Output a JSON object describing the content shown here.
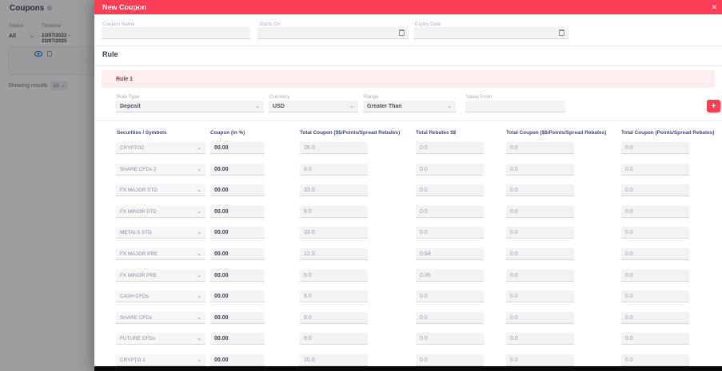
{
  "background": {
    "title": "Coupons",
    "gear_icon": "gear-icon",
    "status_label": "Status",
    "status_value": "All",
    "timeline_label": "Timeline",
    "timeline_value": "23/07/2022 - 22/07/2025",
    "showing_results_label": "Showing results",
    "showing_results_value": "10",
    "card_icons": [
      "eye-icon",
      "copy-icon"
    ]
  },
  "modal": {
    "title": "New Coupon",
    "close_icon": "✕",
    "form": {
      "coupon_name_label": "Coupon Name",
      "coupon_name_value": "",
      "starts_on_label": "Starts On",
      "starts_on_value": "",
      "expiry_date_label": "Expiry Date",
      "expiry_date_value": ""
    },
    "rule_section": {
      "heading": "Rule",
      "rule_banner": "Rule 1",
      "rule_type_label": "Rule Type",
      "rule_type_value": "Deposit",
      "currency_label": "Currency",
      "currency_value": "USD",
      "range_label": "Range",
      "range_value": "Greater Than",
      "value_from_label": "Value From",
      "value_from_value": "",
      "add_button_label": "+"
    },
    "table": {
      "headers": [
        "Securities / Symbols",
        "Coupon (in %)",
        "Total Coupon ($$/Points/Spread Rebates)",
        "Total Rebates $$",
        "Total Coupon ($$/Points/Spread Rebates)",
        "Total Coupon (Points/Spread Rebates)"
      ],
      "rows": [
        {
          "security": "CRYPTO2",
          "coupon": "00.00",
          "total_coupon": "26.0",
          "total_rebates": "0.0",
          "total_coupon_2": "0.0",
          "total_coupon_3": "0.0"
        },
        {
          "security": "SHARE CFDs 2",
          "coupon": "00.00",
          "total_coupon": "9.0",
          "total_rebates": "0.0",
          "total_coupon_2": "0.0",
          "total_coupon_3": "0.0"
        },
        {
          "security": "FX MAJOR STD",
          "coupon": "00.00",
          "total_coupon": "33.0",
          "total_rebates": "0.0",
          "total_coupon_2": "0.0",
          "total_coupon_3": "0.0"
        },
        {
          "security": "FX MINOR STD",
          "coupon": "00.00",
          "total_coupon": "9.0",
          "total_rebates": "0.0",
          "total_coupon_2": "0.0",
          "total_coupon_3": "0.0"
        },
        {
          "security": "METALS STD",
          "coupon": "00.00",
          "total_coupon": "33.0",
          "total_rebates": "0.0",
          "total_coupon_2": "0.0",
          "total_coupon_3": "0.0"
        },
        {
          "security": "FX MAJOR PRE",
          "coupon": "00.00",
          "total_coupon": "12.0",
          "total_rebates": "0.94",
          "total_coupon_2": "0.0",
          "total_coupon_3": "0.0"
        },
        {
          "security": "FX MINOR PRE",
          "coupon": "00.00",
          "total_coupon": "5.0",
          "total_rebates": "0.35",
          "total_coupon_2": "0.0",
          "total_coupon_3": "0.0"
        },
        {
          "security": "CASH CFDs",
          "coupon": "00.00",
          "total_coupon": "9.0",
          "total_rebates": "0.0",
          "total_coupon_2": "0.0",
          "total_coupon_3": "0.0"
        },
        {
          "security": "SHARE CFDs",
          "coupon": "00.00",
          "total_coupon": "9.0",
          "total_rebates": "0.0",
          "total_coupon_2": "0.0",
          "total_coupon_3": "0.0"
        },
        {
          "security": "FUTURE CFDs",
          "coupon": "00.00",
          "total_coupon": "9.0",
          "total_rebates": "0.0",
          "total_coupon_2": "0.0",
          "total_coupon_3": "0.0"
        },
        {
          "security": "CRYPTO 1",
          "coupon": "00.00",
          "total_coupon": "20.0",
          "total_rebates": "0.0",
          "total_coupon_2": "0.0",
          "total_coupon_3": "0.0"
        }
      ]
    }
  },
  "colors": {
    "accent_red": "#fb3e53",
    "rule_banner_bg": "#fcedef",
    "rule_banner_text": "#7d3d49",
    "table_header_text": "#3f4d79",
    "input_bg": "#f3f3f6"
  }
}
